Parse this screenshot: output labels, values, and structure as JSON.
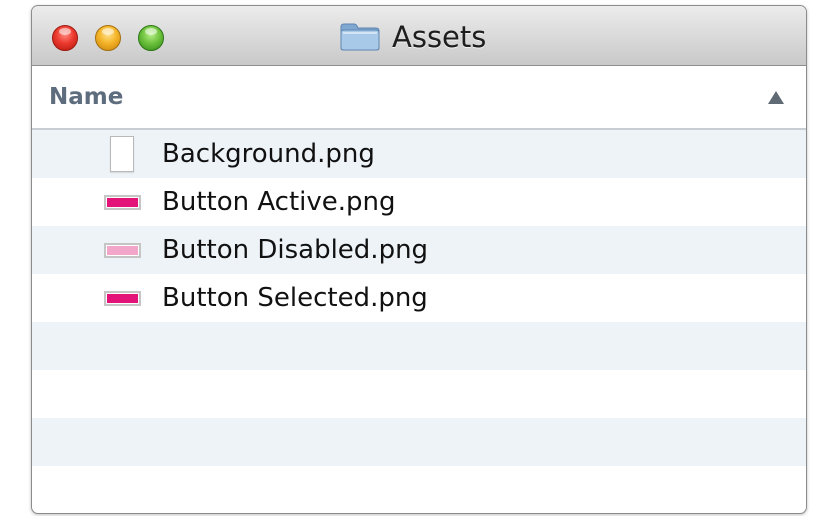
{
  "window": {
    "title": "Assets",
    "title_icon": "folder-icon",
    "controls": [
      "close",
      "minimize",
      "zoom"
    ]
  },
  "header": {
    "column_label": "Name",
    "sort_indicator": "sort-ascending-icon"
  },
  "files": [
    {
      "name": "Background.png",
      "icon": "document-icon",
      "color": "#ffffff"
    },
    {
      "name": "Button Active.png",
      "icon": "pink-swatch-icon",
      "color": "#e3137a"
    },
    {
      "name": "Button Disabled.png",
      "icon": "light-pink-swatch-icon",
      "color": "#f2a6c9"
    },
    {
      "name": "Button Selected.png",
      "icon": "pink-swatch-icon",
      "color": "#e3137a"
    }
  ],
  "colors": {
    "row_stripe": "#eef3f8",
    "header_text": "#5d6d7e"
  }
}
